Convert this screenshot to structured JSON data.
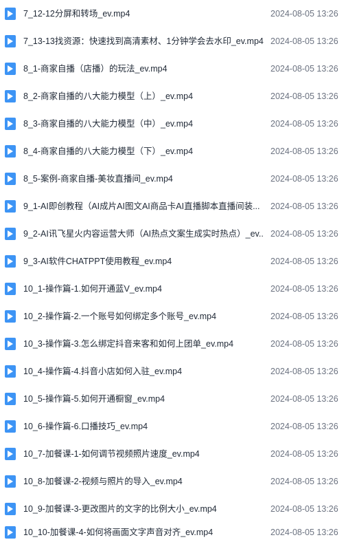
{
  "icon": "video-file-icon",
  "accent_color": "#3d94f5",
  "files": [
    {
      "name": "7_12-12分屏和转场_ev.mp4",
      "date": "2024-08-05 13:26"
    },
    {
      "name": "7_13-13找资源：快速找到高清素材、1分钟学会去水印_ev.mp4",
      "date": "2024-08-05 13:26"
    },
    {
      "name": "8_1-商家自播（店播）的玩法_ev.mp4",
      "date": "2024-08-05 13:26"
    },
    {
      "name": "8_2-商家自播的八大能力模型（上）_ev.mp4",
      "date": "2024-08-05 13:26"
    },
    {
      "name": "8_3-商家自播的八大能力模型（中）_ev.mp4",
      "date": "2024-08-05 13:26"
    },
    {
      "name": "8_4-商家自播的八大能力模型（下）_ev.mp4",
      "date": "2024-08-05 13:26"
    },
    {
      "name": "8_5-案例-商家自播-美妆直播间_ev.mp4",
      "date": "2024-08-05 13:26"
    },
    {
      "name": "9_1-AI即创教程（AI成片AI图文AI商品卡AI直播脚本直播间装...",
      "date": "2024-08-05 13:26"
    },
    {
      "name": "9_2-AI讯飞星火内容运营大师（AI热点文案生成实时热点）_ev....",
      "date": "2024-08-05 13:26"
    },
    {
      "name": "9_3-AI软件CHATPPT使用教程_ev.mp4",
      "date": "2024-08-05 13:26"
    },
    {
      "name": "10_1-操作篇-1.如何开通蓝V_ev.mp4",
      "date": "2024-08-05 13:26"
    },
    {
      "name": "10_2-操作篇-2.一个账号如何绑定多个账号_ev.mp4",
      "date": "2024-08-05 13:26"
    },
    {
      "name": "10_3-操作篇-3.怎么绑定抖音来客和如何上团单_ev.mp4",
      "date": "2024-08-05 13:26"
    },
    {
      "name": "10_4-操作篇-4.抖音小店如何入驻_ev.mp4",
      "date": "2024-08-05 13:26"
    },
    {
      "name": "10_5-操作篇-5.如何开通橱窗_ev.mp4",
      "date": "2024-08-05 13:26"
    },
    {
      "name": "10_6-操作篇-6.口播技巧_ev.mp4",
      "date": "2024-08-05 13:26"
    },
    {
      "name": "10_7-加餐课-1-如何调节视频照片速度_ev.mp4",
      "date": "2024-08-05 13:26"
    },
    {
      "name": "10_8-加餐课-2-视频与照片的导入_ev.mp4",
      "date": "2024-08-05 13:26"
    },
    {
      "name": "10_9-加餐课-3-更改图片的文字的比例大小_ev.mp4",
      "date": "2024-08-05 13:26"
    },
    {
      "name": "10_10-加餐课-4-如何将画面文字声音对齐_ev.mp4",
      "date": "2024-08-05 13:26"
    }
  ]
}
